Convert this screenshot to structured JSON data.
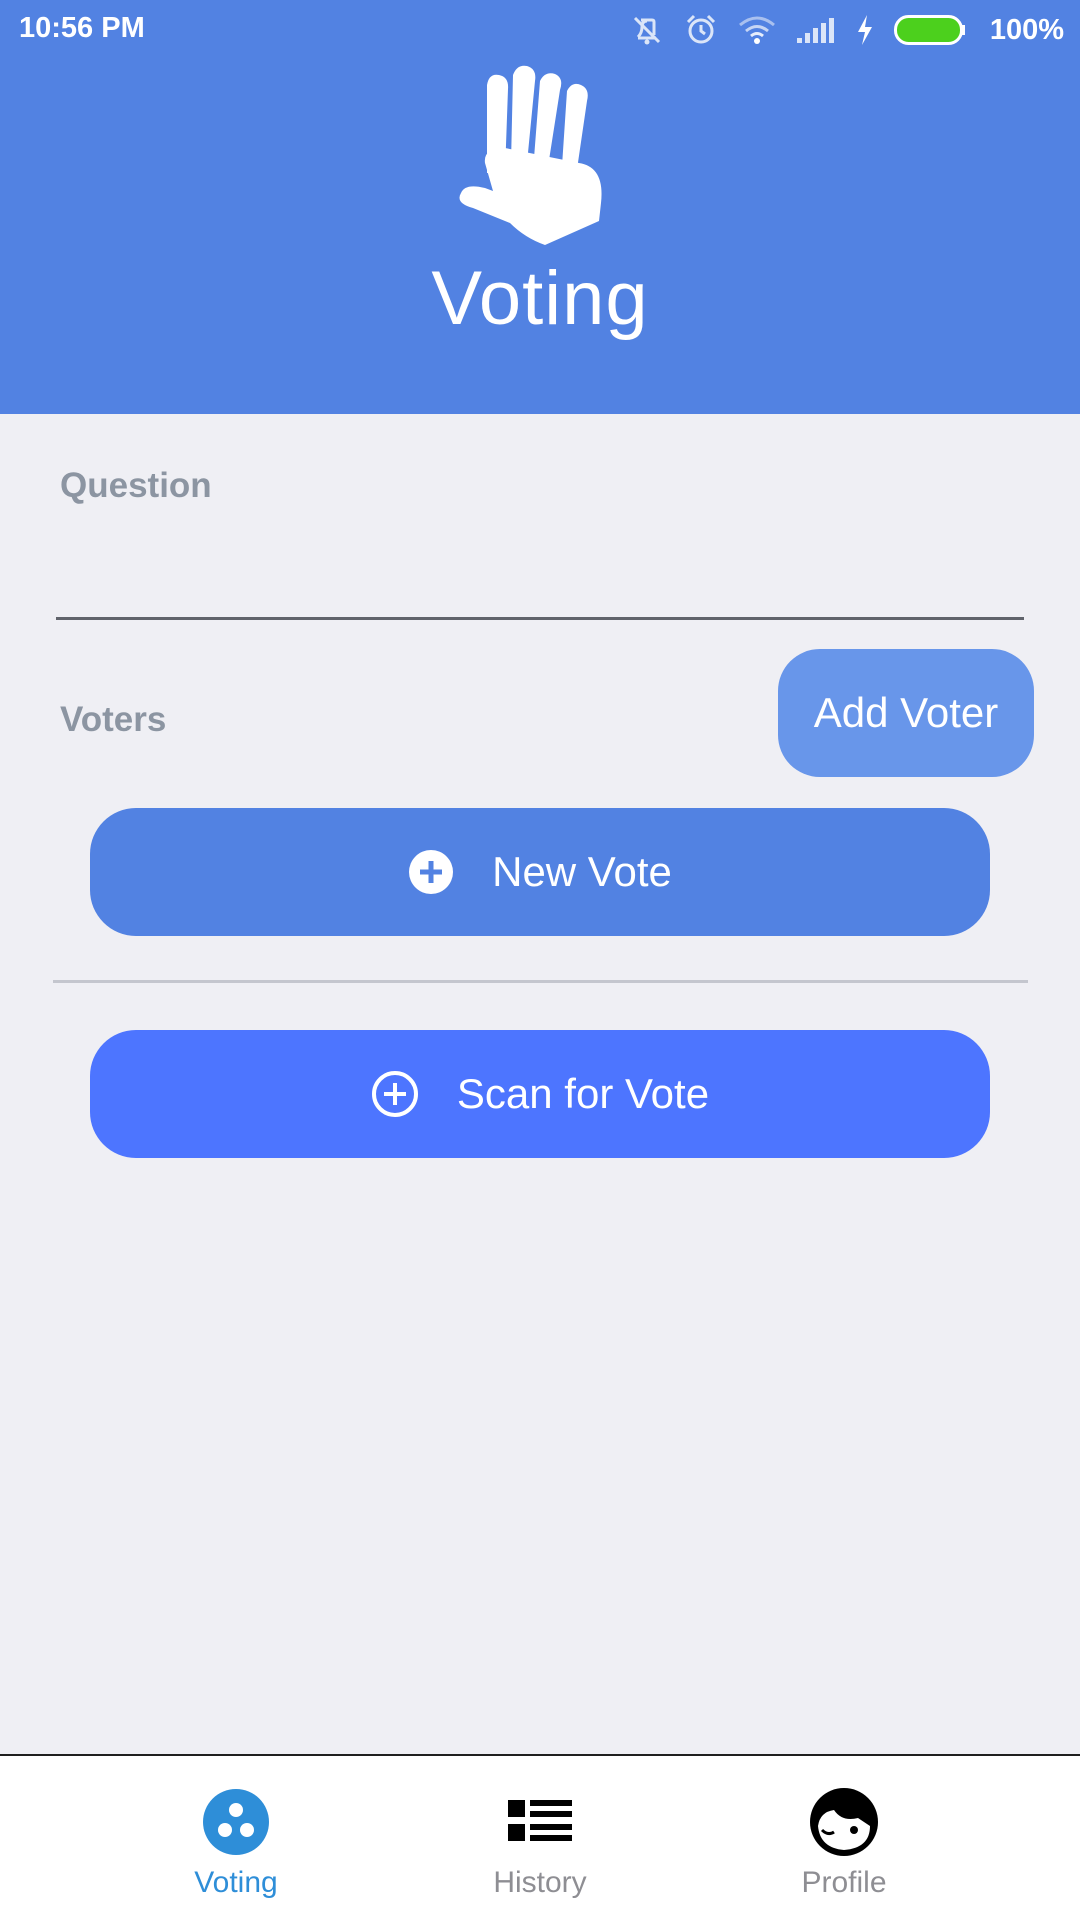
{
  "status_bar": {
    "time": "10:56 PM",
    "battery_percent": "100%",
    "icons": [
      "vibrate-off-icon",
      "alarm-icon",
      "wifi-icon",
      "signal-icon",
      "charging-icon",
      "battery-icon"
    ]
  },
  "header": {
    "title": "Voting",
    "logo_icon": "raised-hand-icon",
    "background": "#5282e2"
  },
  "form": {
    "question_label": "Question",
    "question_value": "",
    "voters_label": "Voters",
    "add_voter_label": "Add Voter"
  },
  "actions": {
    "new_vote_label": "New Vote",
    "scan_vote_label": "Scan for Vote"
  },
  "tabs": [
    {
      "label": "Voting",
      "icon": "voting-icon",
      "active": true
    },
    {
      "label": "History",
      "icon": "list-icon",
      "active": false
    },
    {
      "label": "Profile",
      "icon": "profile-icon",
      "active": false
    }
  ],
  "colors": {
    "accent": "#5282e2",
    "scan_button": "#4d75ff",
    "add_voter_button": "#6896ea",
    "active_tab": "#2e8ed8",
    "inactive_tab": "#8e8e93",
    "battery": "#4cd01d"
  }
}
